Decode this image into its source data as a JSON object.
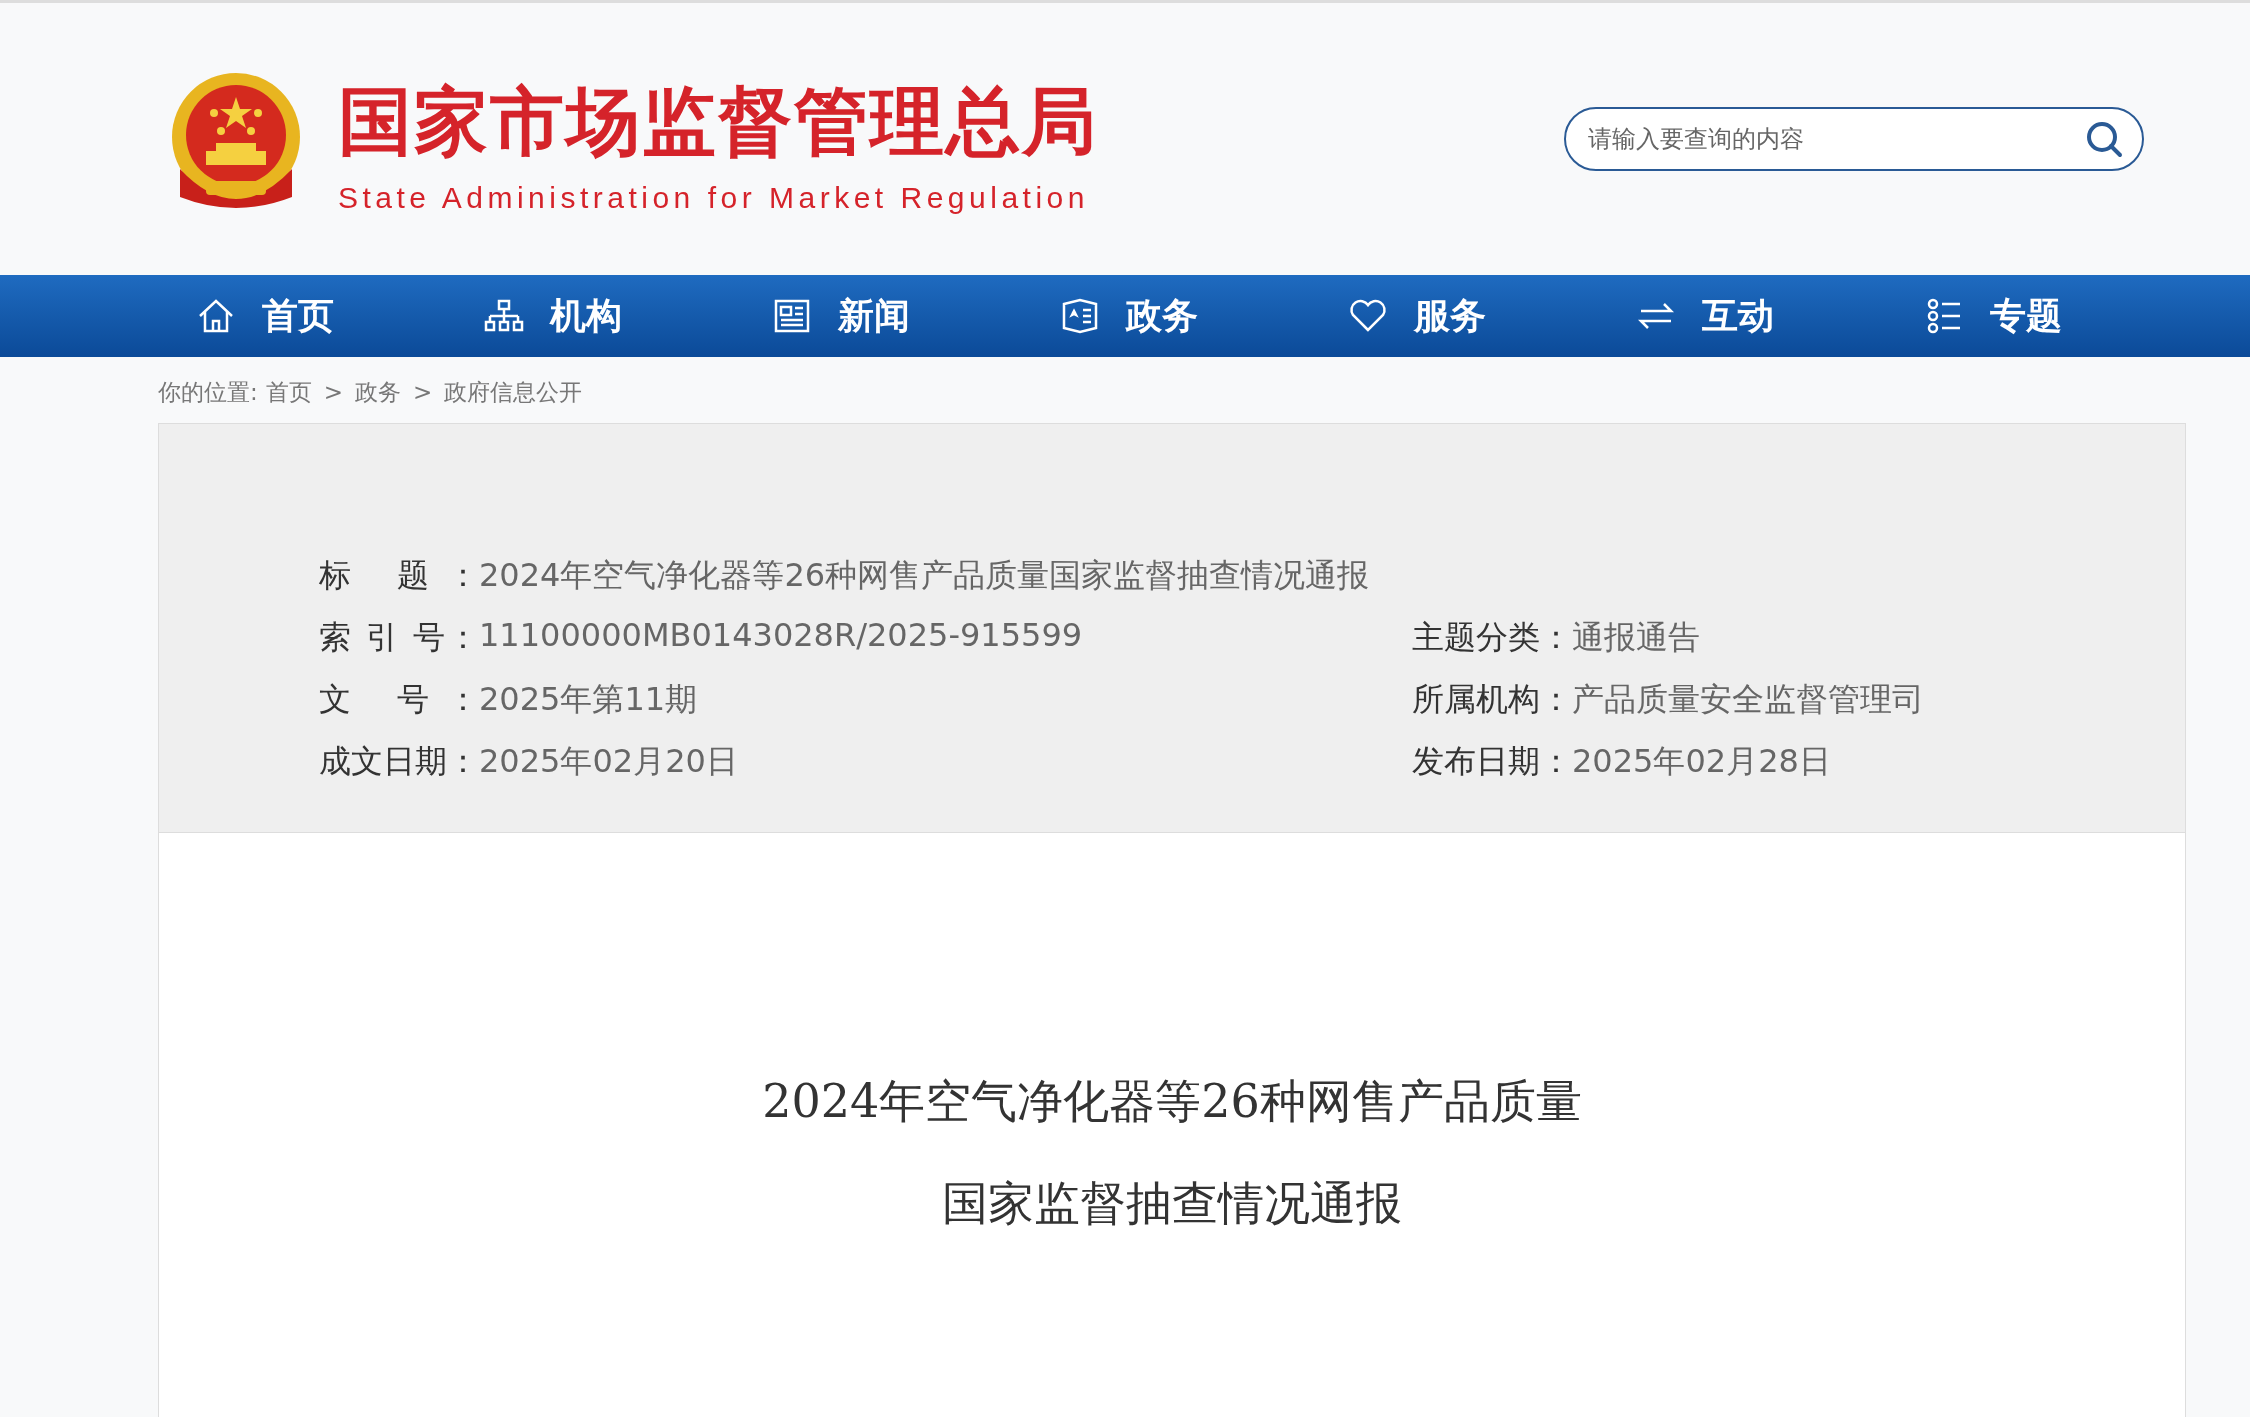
{
  "header": {
    "title": "国家市场监督管理总局",
    "subtitle": "State Administration for Market Regulation"
  },
  "search": {
    "placeholder": "请输入要查询的内容"
  },
  "nav": [
    {
      "label": "首页",
      "kind": "home"
    },
    {
      "label": "机构",
      "kind": "org"
    },
    {
      "label": "新闻",
      "kind": "news"
    },
    {
      "label": "政务",
      "kind": "gov"
    },
    {
      "label": "服务",
      "kind": "heart"
    },
    {
      "label": "互动",
      "kind": "swap"
    },
    {
      "label": "专题",
      "kind": "topic"
    }
  ],
  "breadcrumb": {
    "prefix": "你的位置:",
    "items": [
      "首页",
      "政务",
      "政府信息公开"
    ],
    "separator": ">"
  },
  "meta": [
    {
      "label": "标 题：",
      "value": "2024年空气净化器等26种网售产品质量国家监督抽查情况通报"
    },
    {
      "label": "索 引 号：",
      "value": "11100000MB0143028R/2025-915599",
      "side_label": "主题分类：",
      "side_value": "通报通告"
    },
    {
      "label": "文 号：",
      "value": "2025年第11期",
      "side_label": "所属机构：",
      "side_value": "产品质量安全监督管理司"
    },
    {
      "label": "成文日期：",
      "value": "2025年02月20日",
      "side_label": "发布日期：",
      "side_value": "2025年02月28日"
    }
  ],
  "article": {
    "title_lines": [
      "2024年空气净化器等26种网售产品质量",
      "国家监督抽查情况通报"
    ]
  }
}
